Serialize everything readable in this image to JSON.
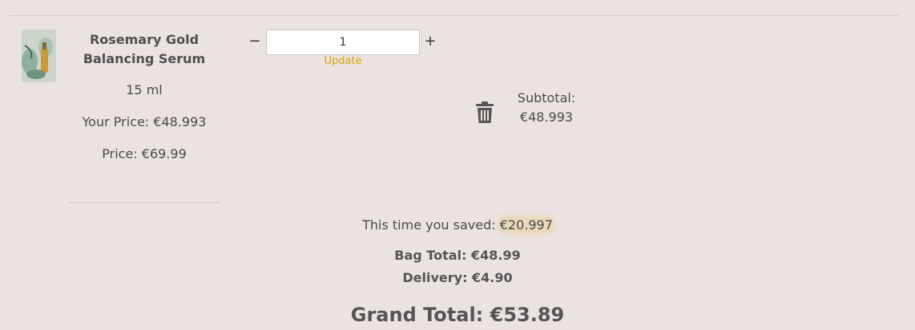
{
  "product": {
    "name_line1": "Rosemary Gold",
    "name_line2": "Balancing Serum",
    "size": "15 ml",
    "your_price": "Your Price: €48.993",
    "price": "Price: €69.99"
  },
  "quantity": {
    "minus_label": "−",
    "value": "1",
    "plus_label": "+",
    "update_label": "Update"
  },
  "subtotal": {
    "label": "Subtotal:",
    "value": "€48.993"
  },
  "summary": {
    "saved_prefix": "This time you saved: ",
    "saved_amount": "€20.997",
    "bag_total": "Bag Total: €48.99",
    "delivery": "Delivery: €4.90",
    "grand_total": "Grand Total: €53.89"
  },
  "colors": {
    "background": "#ebe3e1",
    "accent": "#d9a400"
  },
  "icons": {
    "delete": "trash-icon"
  }
}
